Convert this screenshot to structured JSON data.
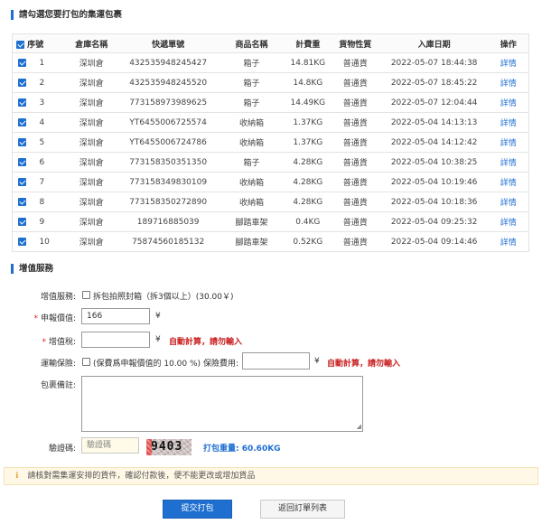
{
  "section_parcels": {
    "title": "請勾選您要打包的集運包裹"
  },
  "table": {
    "headers": {
      "seq": "序號",
      "warehouse": "倉庫名稱",
      "tracking": "快遞單號",
      "product": "商品名稱",
      "weight": "計費重",
      "nature": "貨物性質",
      "date": "入庫日期",
      "action": "操作"
    },
    "rows": [
      {
        "seq": "1",
        "warehouse": "深圳倉",
        "tracking": "432535948245427",
        "product": "箱子",
        "weight": "14.81KG",
        "nature": "普通貨",
        "date": "2022-05-07 18:44:38",
        "action": "詳情"
      },
      {
        "seq": "2",
        "warehouse": "深圳倉",
        "tracking": "432535948245520",
        "product": "箱子",
        "weight": "14.8KG",
        "nature": "普通貨",
        "date": "2022-05-07 18:45:22",
        "action": "詳情"
      },
      {
        "seq": "3",
        "warehouse": "深圳倉",
        "tracking": "773158973989625",
        "product": "箱子",
        "weight": "14.49KG",
        "nature": "普通貨",
        "date": "2022-05-07 12:04:44",
        "action": "詳情"
      },
      {
        "seq": "4",
        "warehouse": "深圳倉",
        "tracking": "YT6455006725574",
        "product": "收納箱",
        "weight": "1.37KG",
        "nature": "普通貨",
        "date": "2022-05-04 14:13:13",
        "action": "詳情"
      },
      {
        "seq": "5",
        "warehouse": "深圳倉",
        "tracking": "YT6455006724786",
        "product": "收納箱",
        "weight": "1.37KG",
        "nature": "普通貨",
        "date": "2022-05-04 14:12:42",
        "action": "詳情"
      },
      {
        "seq": "6",
        "warehouse": "深圳倉",
        "tracking": "773158350351350",
        "product": "箱子",
        "weight": "4.28KG",
        "nature": "普通貨",
        "date": "2022-05-04 10:38:25",
        "action": "詳情"
      },
      {
        "seq": "7",
        "warehouse": "深圳倉",
        "tracking": "773158349830109",
        "product": "收納箱",
        "weight": "4.28KG",
        "nature": "普通貨",
        "date": "2022-05-04 10:19:46",
        "action": "詳情"
      },
      {
        "seq": "8",
        "warehouse": "深圳倉",
        "tracking": "773158350272890",
        "product": "收納箱",
        "weight": "4.28KG",
        "nature": "普通貨",
        "date": "2022-05-04 10:18:36",
        "action": "詳情"
      },
      {
        "seq": "9",
        "warehouse": "深圳倉",
        "tracking": "189716885039",
        "product": "腳踏車架",
        "weight": "0.4KG",
        "nature": "普通貨",
        "date": "2022-05-04 09:25:32",
        "action": "詳情"
      },
      {
        "seq": "10",
        "warehouse": "深圳倉",
        "tracking": "75874560185132",
        "product": "腳踏車架",
        "weight": "0.52KG",
        "nature": "普通貨",
        "date": "2022-05-04 09:14:46",
        "action": "詳情"
      }
    ]
  },
  "section_value_added": {
    "title": "增值服務"
  },
  "form": {
    "service_label": "增值服務:",
    "service_option": "拆包拍照封箱（拆3個以上）(30.00￥)",
    "declared_label": "申報價值:",
    "declared_value": "166",
    "currency": "¥",
    "tax_label": "增值稅:",
    "tax_value": "",
    "auto_calc": "自動計算，請勿輸入",
    "insurance_label": "運輸保險:",
    "insurance_option": "(保費爲申報價值的 10.00 %)",
    "insurance_fee_label": "保險費用:",
    "insurance_fee_value": "",
    "remark_label": "包裹備註:",
    "captcha_label": "驗證碼:",
    "captcha_placeholder": "驗證碼",
    "captcha_code": "9403",
    "pack_weight": "打包重量: 60.60KG"
  },
  "notice": {
    "icon": "info-icon",
    "text": "請核對需集運安排的貨件，確認付款後，便不能更改或增加貨品"
  },
  "buttons": {
    "submit": "提交打包",
    "back": "返回訂單列表"
  },
  "colors": {
    "accent": "#1f6fd1",
    "warning": "#c81c1c",
    "notice_bg": "#fff8e6"
  }
}
